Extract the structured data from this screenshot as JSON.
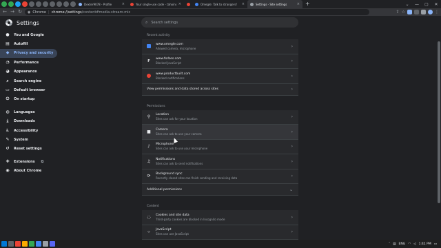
{
  "tabs": [
    {
      "title": "Dexter9078 - Profile",
      "active": false,
      "color": "#8ab4f8"
    },
    {
      "title": "Your single-use code - tahoinoki...",
      "active": false,
      "color": "#ea4335"
    },
    {
      "title": "Omegle: Talk to strangers!",
      "active": false,
      "color": "#4285f4"
    },
    {
      "title": "Settings - Site settings",
      "active": true,
      "color": "#9aa0a6"
    }
  ],
  "omnibox": {
    "prefix": "Chrome",
    "host": "chrome://settings",
    "path": "/content#media-stream-mic"
  },
  "header": {
    "title": "Settings",
    "search_placeholder": "Search settings"
  },
  "sidebar": {
    "items": [
      {
        "label": "You and Google",
        "icon": "person-icon",
        "glyph": "●"
      },
      {
        "label": "Autofill",
        "icon": "autofill-icon",
        "glyph": "▤"
      },
      {
        "label": "Privacy and security",
        "icon": "shield-icon",
        "glyph": "◆",
        "active": true
      },
      {
        "label": "Performance",
        "icon": "speedometer-icon",
        "glyph": "◔"
      },
      {
        "label": "Appearance",
        "icon": "palette-icon",
        "glyph": "◕"
      },
      {
        "label": "Search engine",
        "icon": "search-icon",
        "glyph": "⌕"
      },
      {
        "label": "Default browser",
        "icon": "browser-icon",
        "glyph": "▭"
      },
      {
        "label": "On startup",
        "icon": "power-icon",
        "glyph": "⏻"
      }
    ],
    "items2": [
      {
        "label": "Languages",
        "icon": "globe-icon",
        "glyph": "◍"
      },
      {
        "label": "Downloads",
        "icon": "download-icon",
        "glyph": "⤓"
      },
      {
        "label": "Accessibility",
        "icon": "accessibility-icon",
        "glyph": "♿"
      },
      {
        "label": "System",
        "icon": "wrench-icon",
        "glyph": "✎"
      },
      {
        "label": "Reset settings",
        "icon": "reset-icon",
        "glyph": "↺"
      }
    ],
    "items3": [
      {
        "label": "Extensions",
        "icon": "puzzle-icon",
        "glyph": "✚"
      },
      {
        "label": "About Chrome",
        "icon": "chrome-icon",
        "glyph": "◉"
      }
    ]
  },
  "recent": {
    "heading": "Recent activity",
    "items": [
      {
        "name": "www.omegle.com",
        "desc": "Allowed camera, microphone",
        "color": "#4285f4"
      },
      {
        "name": "www.forbes.com",
        "desc": "Blocked JavaScript",
        "color": "#e8eaed"
      },
      {
        "name": "www.productbuilt.com",
        "desc": "Blocked notifications",
        "color": "#ea4335"
      }
    ],
    "view_all": "View permissions and data stored across sites"
  },
  "permissions": {
    "heading": "Permissions",
    "items": [
      {
        "name": "Location",
        "desc": "Sites can ask for your location",
        "icon": "location-icon",
        "glyph": "⚲"
      },
      {
        "name": "Camera",
        "desc": "Sites can ask to use your camera",
        "icon": "camera-icon",
        "glyph": "■",
        "hover": true
      },
      {
        "name": "Microphone",
        "desc": "Sites can ask to use your microphone",
        "icon": "microphone-icon",
        "glyph": "♪"
      },
      {
        "name": "Notifications",
        "desc": "Sites can ask to send notifications",
        "icon": "bell-icon",
        "glyph": "♫"
      },
      {
        "name": "Background sync",
        "desc": "Recently closed sites can finish sending and receiving data",
        "icon": "sync-icon",
        "glyph": "⟳"
      }
    ],
    "additional": "Additional permissions"
  },
  "content": {
    "heading": "Content",
    "items": [
      {
        "name": "Cookies and site data",
        "desc": "Third-party cookies are blocked in Incognito mode",
        "icon": "cookie-icon",
        "glyph": "◌"
      },
      {
        "name": "JavaScript",
        "desc": "Sites can use JavaScript",
        "icon": "code-icon",
        "glyph": "‹›"
      }
    ]
  },
  "tray": {
    "lang": "ENG",
    "time": "1:41 PM"
  }
}
